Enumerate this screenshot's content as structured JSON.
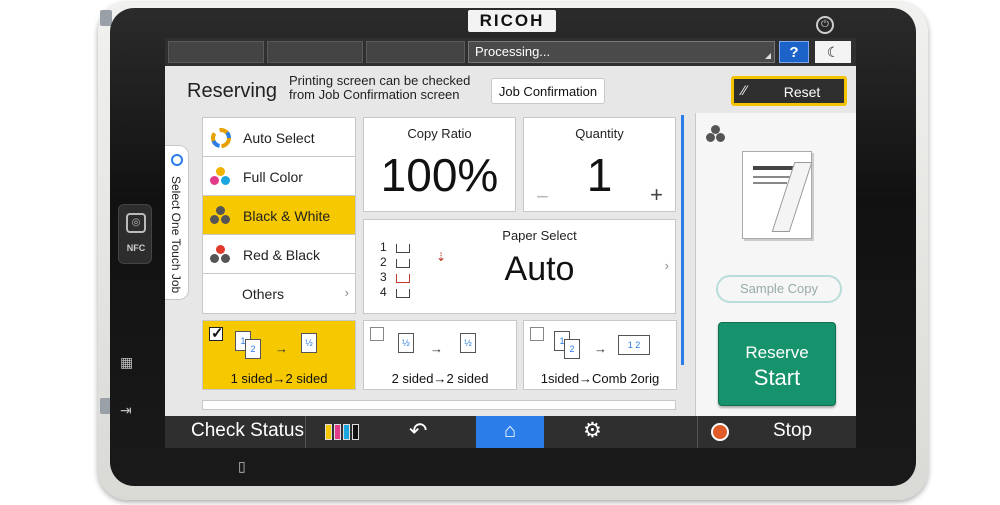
{
  "device": {
    "brand": "RICOH",
    "nfc_label": "NFC"
  },
  "topbar": {
    "status": "Processing...",
    "help_label": "?",
    "sleep_icon": "moon-icon"
  },
  "header": {
    "state": "Reserving",
    "info": "Printing screen can be checked from Job Confirmation screen",
    "job_confirmation": "Job Confirmation",
    "reset": "Reset"
  },
  "one_touch": {
    "label": "Select One Touch Job"
  },
  "color_modes": {
    "items": [
      {
        "label": "Auto Select",
        "selected": false
      },
      {
        "label": "Full Color",
        "selected": false
      },
      {
        "label": "Black & White",
        "selected": true
      },
      {
        "label": "Red & Black",
        "selected": false
      }
    ],
    "others": "Others"
  },
  "copy_ratio": {
    "title": "Copy Ratio",
    "value": "100%"
  },
  "quantity": {
    "title": "Quantity",
    "value": "1",
    "minus": "−",
    "plus": "+"
  },
  "paper_select": {
    "title": "Paper Select",
    "value": "Auto",
    "trays": [
      "1",
      "2",
      "3",
      "4"
    ]
  },
  "duplex": [
    {
      "label": "1 sided→2 sided",
      "checked": true
    },
    {
      "label": "2 sided→2 sided",
      "checked": false
    },
    {
      "label": "1sided→Comb 2orig",
      "checked": false
    }
  ],
  "right_panel": {
    "sample_copy": "Sample Copy",
    "start_line1": "Reserve",
    "start_line2": "Start"
  },
  "bottombar": {
    "check_status": "Check Status",
    "stop": "Stop"
  },
  "colors": {
    "accent_yellow": "#f5c800",
    "start_green": "#16936c",
    "home_blue": "#2b7de9",
    "help_blue": "#1c63c9"
  }
}
